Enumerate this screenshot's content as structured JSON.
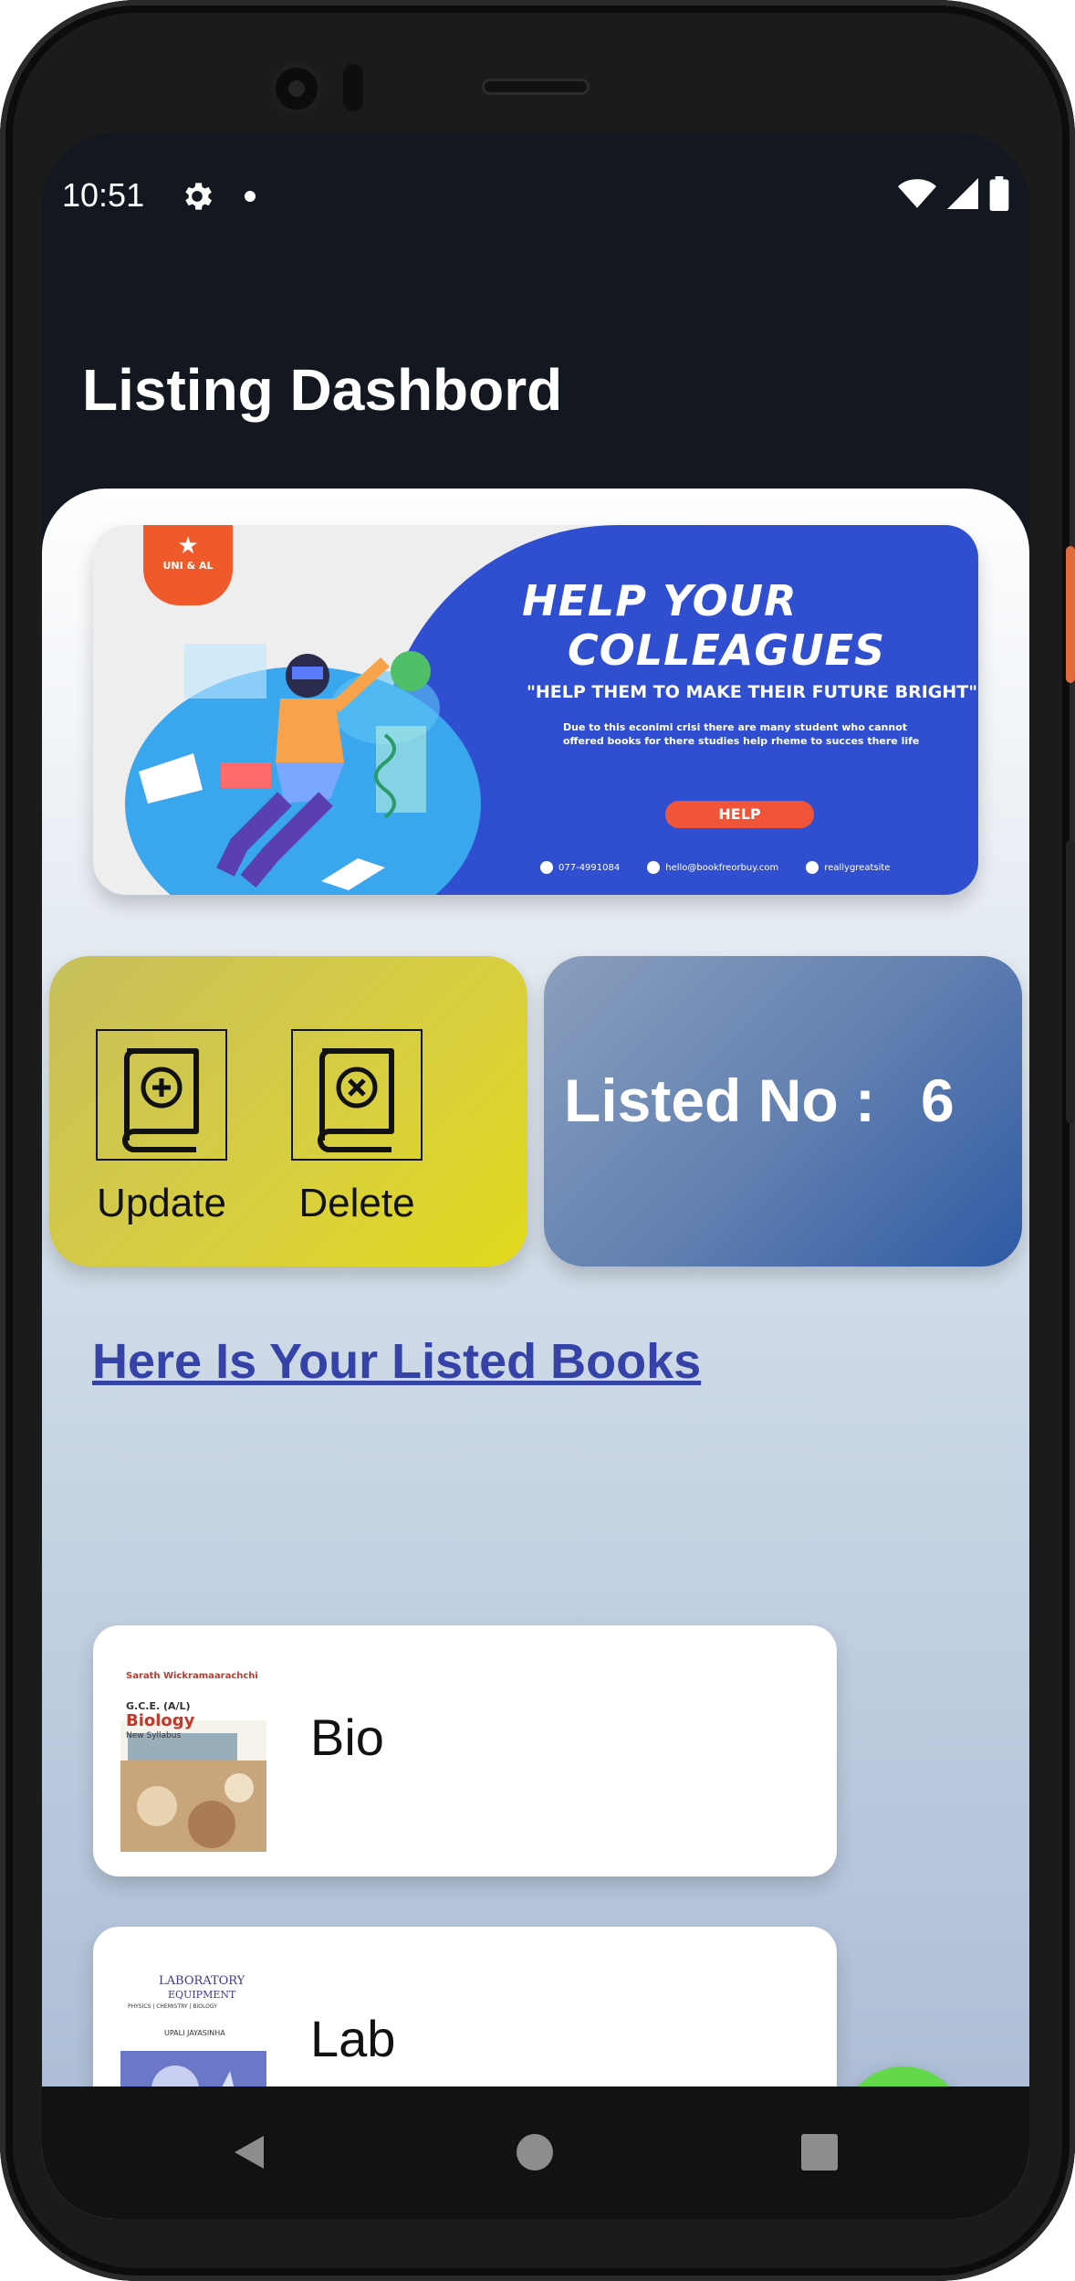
{
  "status_bar": {
    "time": "10:51",
    "icons": [
      "gear-icon",
      "notification-dot",
      "wifi-icon",
      "signal-icon",
      "battery-icon"
    ]
  },
  "header": {
    "title": "Listing Dashbord"
  },
  "banner": {
    "badge": "UNI & AL",
    "title_line1": "HELP YOUR",
    "title_line2": "COLLEAGUES",
    "quote": "\"HELP THEM TO MAKE THEIR FUTURE BRIGHT\"",
    "description": "Due to this econimi crisi there  are many student who cannot offered books for there studies help rheme to succes there life",
    "button": "HELP",
    "phone": "077-4991084",
    "email": "hello@bookfreorbuy.com",
    "site": "reallygreatsite"
  },
  "actions": {
    "update_label": "Update",
    "delete_label": "Delete"
  },
  "listed": {
    "label": "Listed No :",
    "count": "6"
  },
  "section_title": "Here Is Your Listed Books",
  "books": [
    {
      "name": "Bio",
      "cover_author": "Sarath Wickramaarachchi",
      "cover_level": "G.C.E. (A/L)",
      "cover_title": "Biology",
      "cover_sub": "New Syllabus"
    },
    {
      "name": "Lab",
      "cover_title_1": "LABORATORY",
      "cover_title_2": "EQUIPMENT",
      "cover_sub": "PHYSICS | CHEMISTRY | BIOLOGY",
      "cover_author": "UPALI JAYASINHA"
    }
  ],
  "fab": {
    "label": "+"
  },
  "colors": {
    "accent_green": "#63d84b",
    "link_blue": "#3543a8",
    "banner_blue": "#2f4fd0",
    "help_orange": "#f0553a"
  }
}
